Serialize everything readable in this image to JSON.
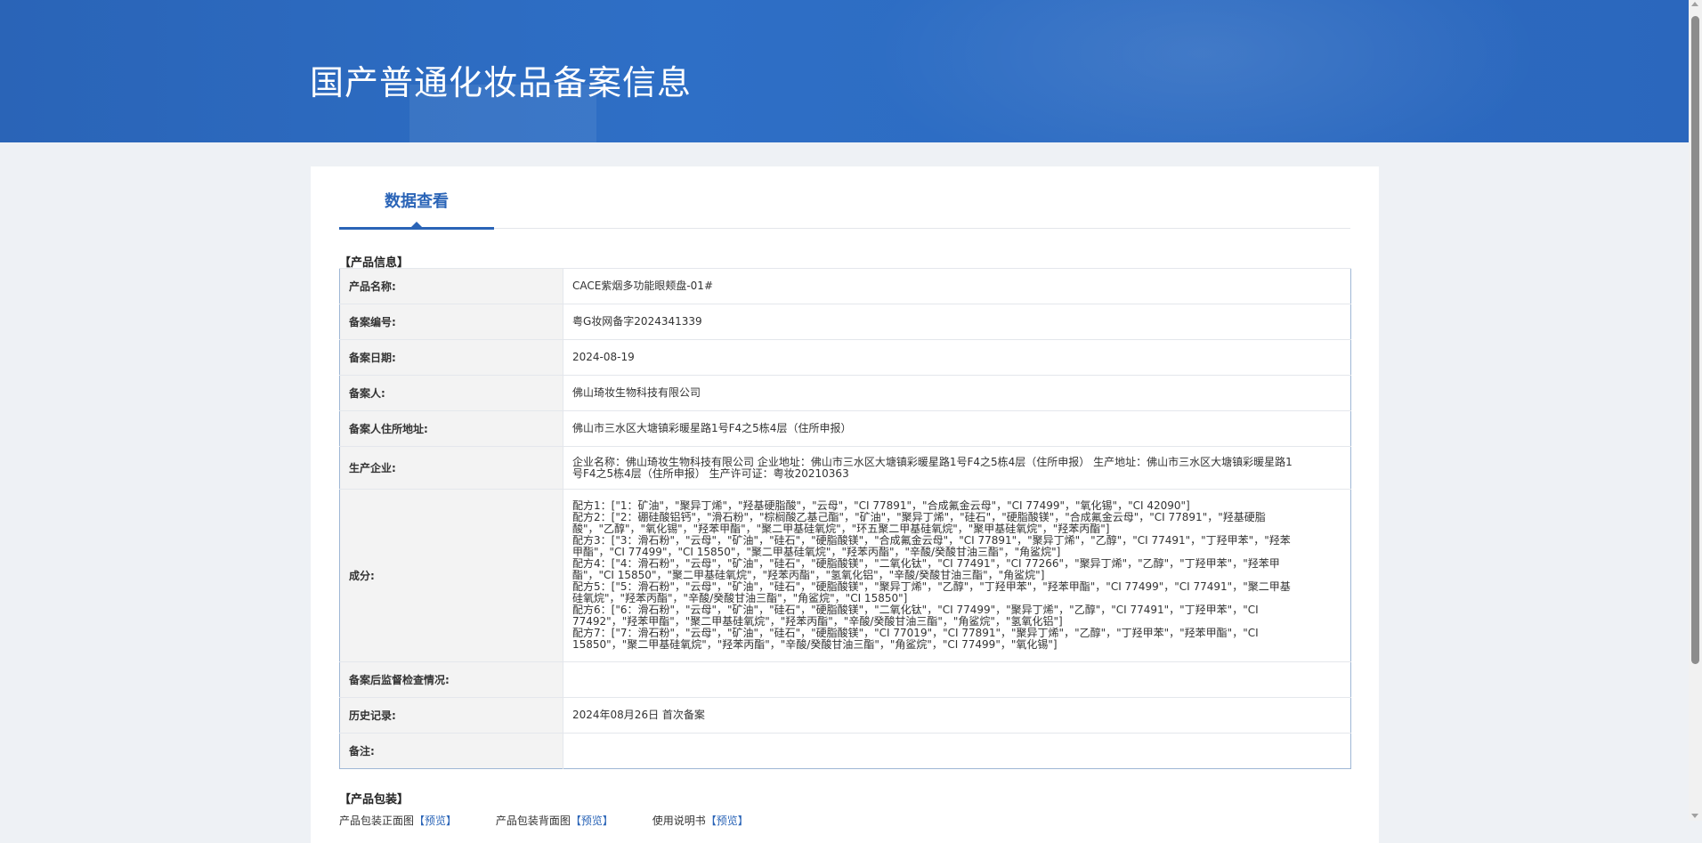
{
  "header": {
    "title": "国产普通化妆品备案信息"
  },
  "tabs": [
    {
      "label": "数据查看"
    }
  ],
  "sections": {
    "product_info": "【产品信息】",
    "packaging": "【产品包装】"
  },
  "product": {
    "rows": [
      {
        "label": "产品名称:",
        "value": "CACE紫烟多功能眼颊盘-01#"
      },
      {
        "label": "备案编号:",
        "value": "粤G妆网备字2024341339"
      },
      {
        "label": "备案日期:",
        "value": "2024-08-19"
      },
      {
        "label": "备案人:",
        "value": "佛山琦妆生物科技有限公司"
      },
      {
        "label": "备案人住所地址:",
        "value": "佛山市三水区大塘镇彩暖星路1号F4之5栋4层（住所申报）"
      },
      {
        "label": "生产企业:",
        "value": "企业名称：佛山琦妆生物科技有限公司 企业地址：佛山市三水区大塘镇彩暖星路1号F4之5栋4层（住所申报） 生产地址：佛山市三水区大塘镇彩暖星路1号F4之5栋4层（住所申报） 生产许可证：粤妆20210363"
      }
    ],
    "ingredients_label": "成分:",
    "ingredients": [
      "配方1：[\"1：矿油\"，\"聚异丁烯\"，\"羟基硬脂酸\"，\"云母\"，\"CI 77891\"，\"合成氟金云母\"，\"CI 77499\"，\"氧化锡\"，\"CI 42090\"]",
      "配方2：[\"2：硼硅酸铝钙\"，\"滑石粉\"，\"棕榈酸乙基己酯\"，\"矿油\"，\"聚异丁烯\"，\"硅石\"，\"硬脂酸镁\"，\"合成氟金云母\"，\"CI 77891\"，\"羟基硬脂酸\"，\"乙醇\"，\"氧化锡\"，\"羟苯甲酯\"，\"聚二甲基硅氧烷\"，\"环五聚二甲基硅氧烷\"，\"聚甲基硅氧烷\"，\"羟苯丙酯\"]",
      "配方3：[\"3：滑石粉\"，\"云母\"，\"矿油\"，\"硅石\"，\"硬脂酸镁\"，\"合成氟金云母\"，\"CI 77891\"，\"聚异丁烯\"，\"乙醇\"，\"CI 77491\"，\"丁羟甲苯\"，\"羟苯甲酯\"，\"CI 77499\"，\"CI 15850\"，\"聚二甲基硅氧烷\"，\"羟苯丙酯\"，\"辛酸/癸酸甘油三酯\"，\"角鲨烷\"]",
      "配方4：[\"4：滑石粉\"，\"云母\"，\"矿油\"，\"硅石\"，\"硬脂酸镁\"，\"二氧化钛\"，\"CI 77491\"，\"CI 77266\"，\"聚异丁烯\"，\"乙醇\"，\"丁羟甲苯\"，\"羟苯甲酯\"，\"CI 15850\"，\"聚二甲基硅氧烷\"，\"羟苯丙酯\"，\"氢氧化铝\"，\"辛酸/癸酸甘油三酯\"，\"角鲨烷\"]",
      "配方5：[\"5：滑石粉\"，\"云母\"，\"矿油\"，\"硅石\"，\"硬脂酸镁\"，\"聚异丁烯\"，\"乙醇\"，\"丁羟甲苯\"，\"羟苯甲酯\"，\"CI 77499\"，\"CI 77491\"，\"聚二甲基硅氧烷\"，\"羟苯丙酯\"，\"辛酸/癸酸甘油三酯\"，\"角鲨烷\"，\"CI 15850\"]",
      "配方6：[\"6：滑石粉\"，\"云母\"，\"矿油\"，\"硅石\"，\"硬脂酸镁\"，\"二氧化钛\"，\"CI 77499\"，\"聚异丁烯\"，\"乙醇\"，\"CI 77491\"，\"丁羟甲苯\"，\"CI 77492\"，\"羟苯甲酯\"，\"聚二甲基硅氧烷\"，\"羟苯丙酯\"，\"辛酸/癸酸甘油三酯\"，\"角鲨烷\"，\"氢氧化铝\"]",
      "配方7：[\"7：滑石粉\"，\"云母\"，\"矿油\"，\"硅石\"，\"硬脂酸镁\"，\"CI 77019\"，\"CI 77891\"，\"聚异丁烯\"，\"乙醇\"，\"丁羟甲苯\"，\"羟苯甲酯\"，\"CI 15850\"，\"聚二甲基硅氧烷\"，\"羟苯丙酯\"，\"辛酸/癸酸甘油三酯\"，\"角鲨烷\"，\"CI 77499\"，\"氧化锡\"]"
    ],
    "tail_rows": [
      {
        "label": "备案后监督检查情况:",
        "value": ""
      },
      {
        "label": "历史记录:",
        "value": "2024年08月26日 首次备案"
      },
      {
        "label": "备注:",
        "value": ""
      }
    ]
  },
  "packaging": {
    "items": [
      {
        "label": "产品包装正面图",
        "link": "【预览】"
      },
      {
        "label": "产品包装背面图",
        "link": "【预览】"
      },
      {
        "label": "使用说明书",
        "link": "【预览】"
      }
    ]
  },
  "colors": {
    "banner": "#2a64b7",
    "accent": "#2a64b7",
    "label_bg": "#f3f3f3",
    "table_border": "#9fb7d5"
  }
}
